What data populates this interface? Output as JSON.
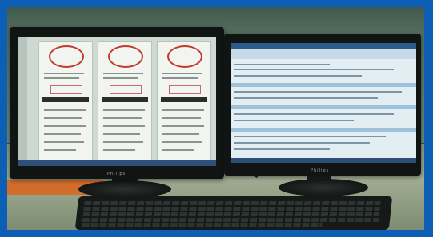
{
  "photo": {
    "subject": "",
    "left_monitor": {
      "brand_text": "Philips"
    },
    "right_monitor": {
      "brand_text": "Philips"
    }
  },
  "colors": {
    "frame": "#0c5fb4",
    "seal_red": "#c0392b",
    "screen_header_blue": "#2c5a8f"
  }
}
